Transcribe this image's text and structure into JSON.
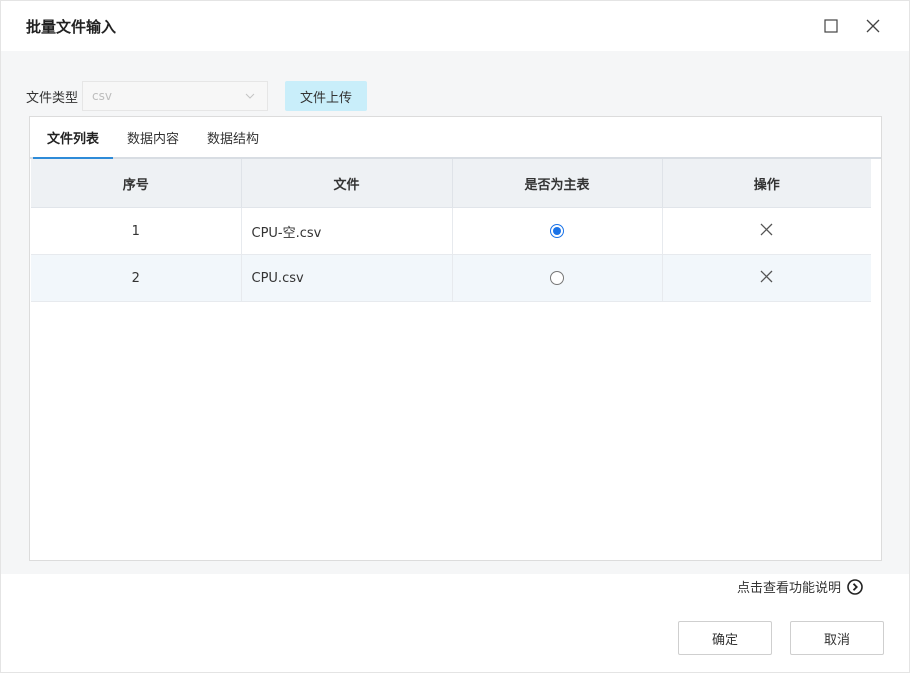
{
  "dialog": {
    "title": "批量文件输入"
  },
  "toolbar": {
    "file_type_label": "文件类型",
    "file_type_value": "csv",
    "upload_label": "文件上传"
  },
  "tabs": [
    {
      "label": "文件列表",
      "active": true
    },
    {
      "label": "数据内容",
      "active": false
    },
    {
      "label": "数据结构",
      "active": false
    }
  ],
  "table": {
    "headers": [
      "序号",
      "文件",
      "是否为主表",
      "操作"
    ],
    "rows": [
      {
        "index": "1",
        "file": "CPU-空.csv",
        "is_main": true
      },
      {
        "index": "2",
        "file": "CPU.csv",
        "is_main": false
      }
    ]
  },
  "help_link": "点击查看功能说明",
  "footer": {
    "ok_label": "确定",
    "cancel_label": "取消"
  },
  "colors": {
    "accent": "#2e8bd8",
    "upload_bg": "#c9eefa",
    "radio_checked": "#1a73e8"
  },
  "icons": [
    "maximize-icon",
    "close-icon",
    "chevron-down-icon",
    "delete-x-icon",
    "circle-arrow-right-icon"
  ]
}
